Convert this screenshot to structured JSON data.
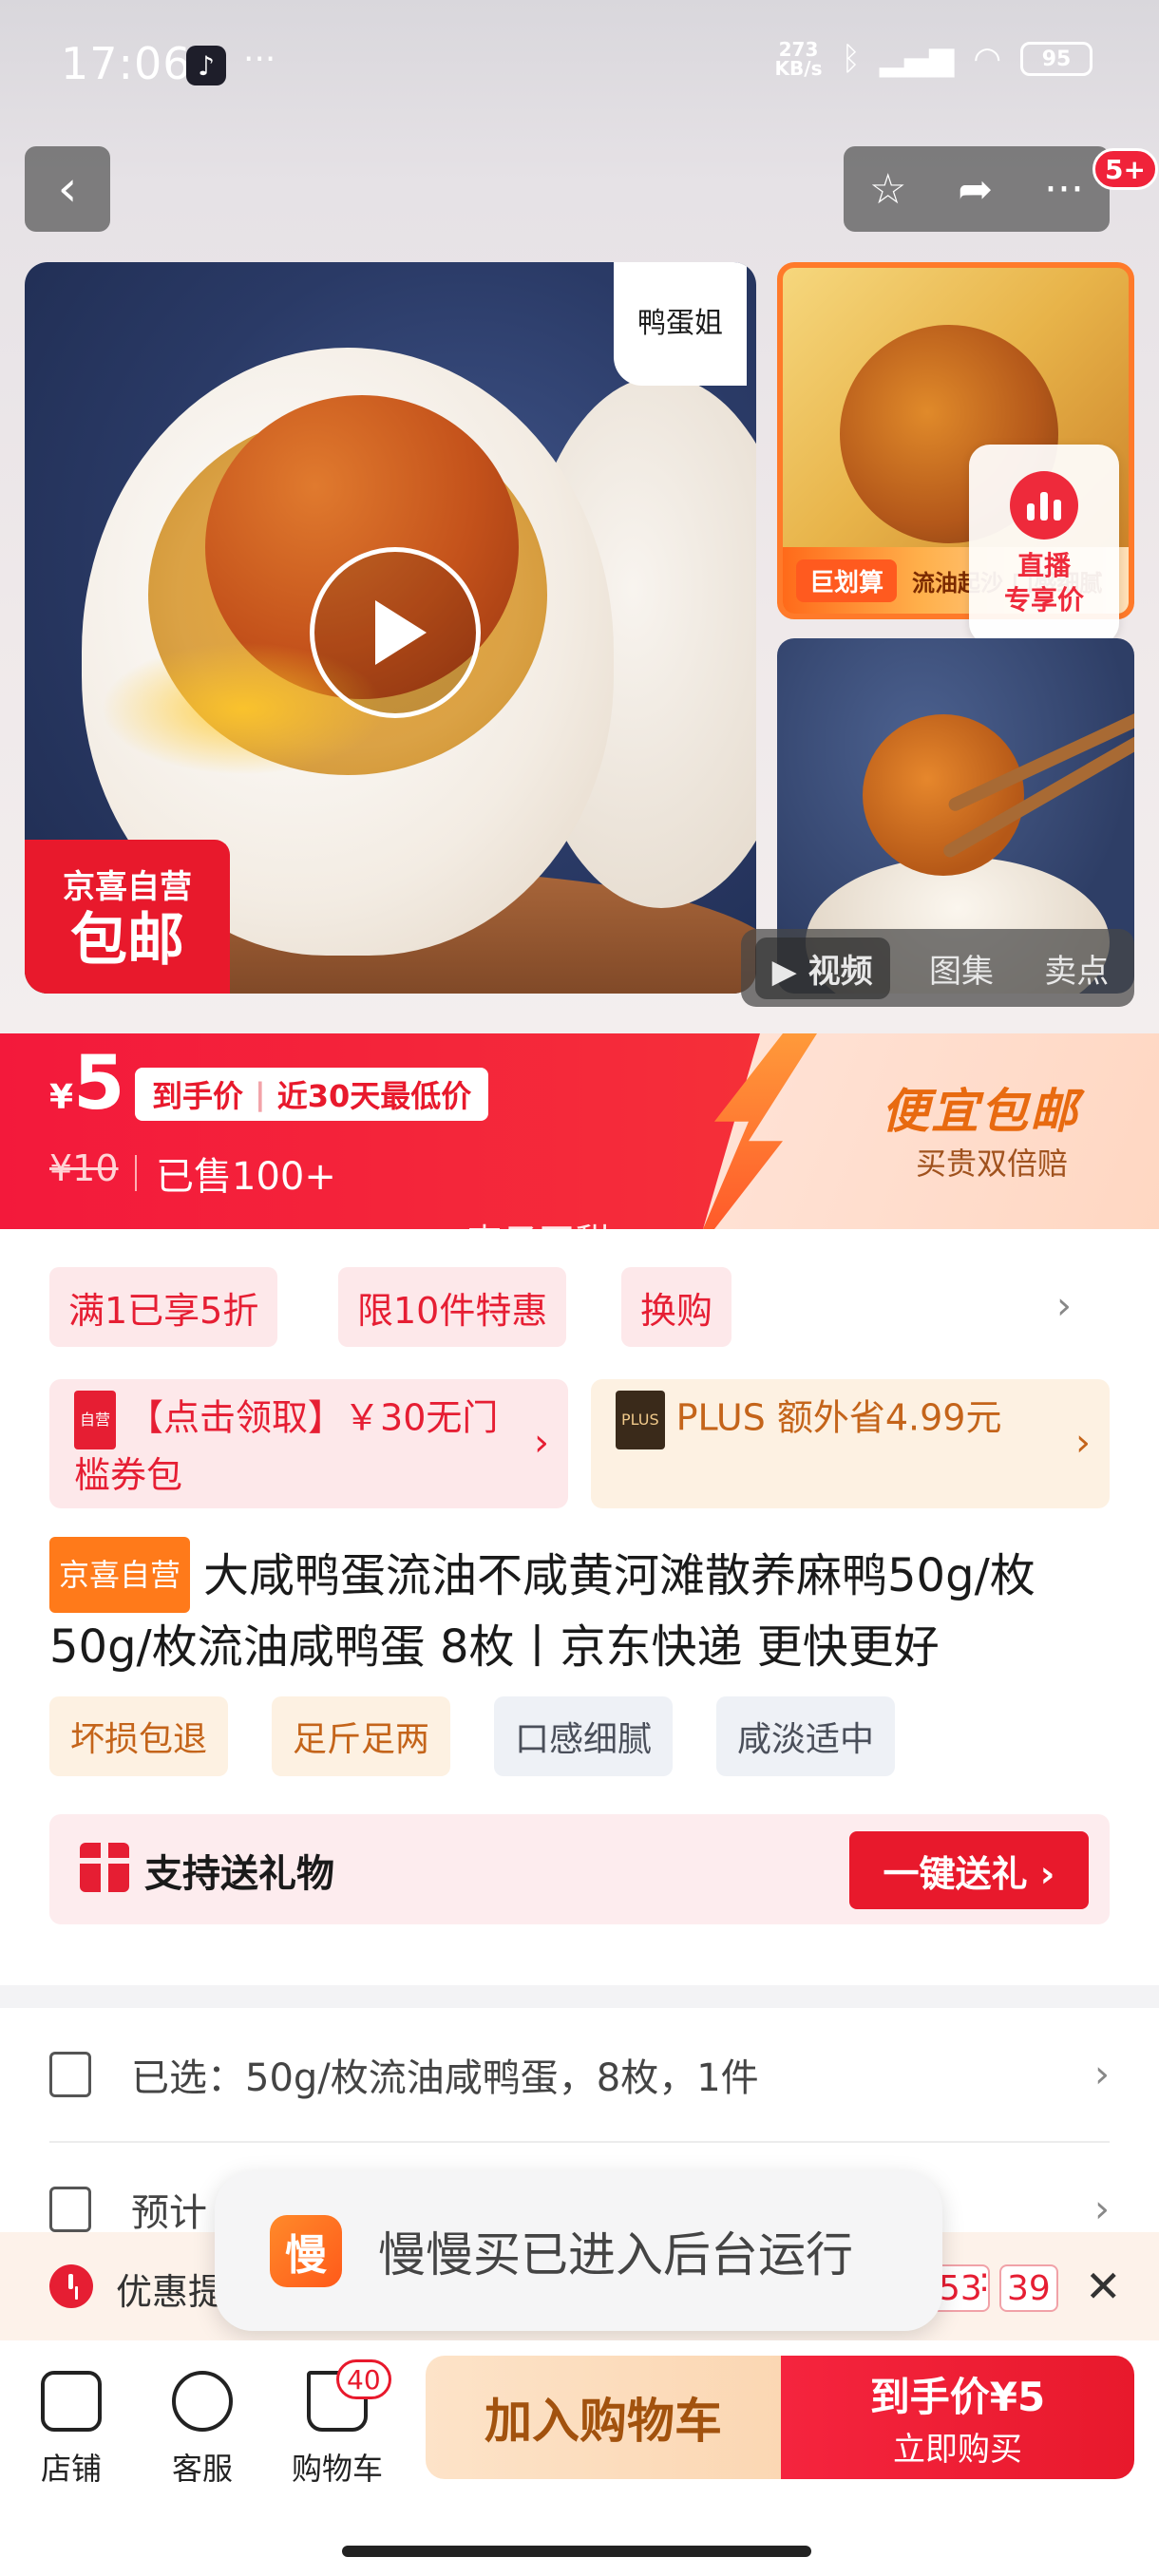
{
  "status_bar": {
    "time": "17:06",
    "net_speed_value": "273",
    "net_speed_unit": "KB/s",
    "battery": "95"
  },
  "nav": {
    "cart_badge": "5+"
  },
  "main_image": {
    "brand_name": "鸭蛋姐",
    "shipping_badge_line1": "京喜自营",
    "shipping_badge_line2": "包邮"
  },
  "thumb1": {
    "tag": "巨划算",
    "caption": "流油起沙 口感细腻"
  },
  "live": {
    "line1": "直播",
    "line2": "专享价"
  },
  "media_tabs": [
    "视频",
    "图集",
    "卖点"
  ],
  "price": {
    "currency": "¥",
    "current": "5",
    "tag_left": "到手价",
    "tag_right": "近30天最低价",
    "original": "¥10",
    "sold": "已售100+",
    "promo_title": "便宜包邮",
    "promo_sub": "买贵双倍赔",
    "watermark": "李子不甜"
  },
  "chips": [
    "满1已享5折",
    "限10件特惠",
    "换购"
  ],
  "coupons": {
    "left_icon": "自营",
    "left_text": "【点击领取】￥30无门槛券包",
    "right_badge": "PLUS",
    "right_text": "PLUS 额外省4.99元"
  },
  "product": {
    "tag": "京喜自营",
    "title": "大咸鸭蛋流油不咸黄河滩散养麻鸭50g/枚 50g/枚流油咸鸭蛋 8枚丨京东快递 更快更好"
  },
  "features": [
    "坏损包退",
    "足斤足两",
    "口感细腻",
    "咸淡适中"
  ],
  "gift": {
    "label": "支持送礼物",
    "button": "一键送礼 ›"
  },
  "selection": {
    "selected": "已选：50g/枚流油咸鸭蛋，8枚，1件",
    "estimate": "预计"
  },
  "promo_strip": {
    "label": "优惠提",
    "minutes": "53",
    "seconds": "39"
  },
  "toast": {
    "icon_char": "慢",
    "text": "慢慢买已进入后台运行"
  },
  "bottom_bar": {
    "store": "店铺",
    "service": "客服",
    "cart": "购物车",
    "cart_count": "40",
    "add_to_cart": "加入购物车",
    "buy_line1": "到手价¥5",
    "buy_line2": "立即购买"
  },
  "colors": {
    "brand_red": "#e8192c",
    "orange": "#ff7a1a"
  }
}
